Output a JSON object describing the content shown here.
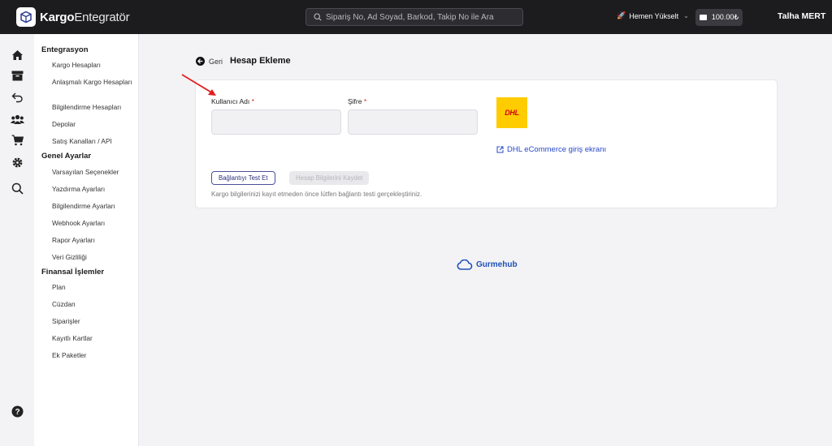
{
  "app": {
    "brand_bold": "Kargo",
    "brand_rest": "Entegratör"
  },
  "topbar": {
    "search_placeholder": "Sipariş No, Ad Soyad, Barkod, Takip No ile Ara",
    "upgrade_label": "Hemen Yükselt",
    "balance": "100.00₺",
    "user_name": "Talha MERT"
  },
  "rail": {
    "icons": [
      "home-icon",
      "archive-icon",
      "return-icon",
      "users-icon",
      "cart-icon",
      "gear-icon",
      "search-icon",
      "help-icon"
    ]
  },
  "sidebar": {
    "sections": [
      {
        "title": "Entegrasyon",
        "items": [
          "Kargo Hesapları",
          "Anlaşmalı Kargo Hesapları",
          "Bilgilendirme Hesapları",
          "Depolar",
          "Satış Kanalları / API"
        ]
      },
      {
        "title": "Genel Ayarlar",
        "items": [
          "Varsayılan Seçenekler",
          "Yazdırma Ayarları",
          "Bilgilendirme Ayarları",
          "Webhook Ayarları",
          "Rapor Ayarları",
          "Veri Gizliliği"
        ]
      },
      {
        "title": "Finansal İşlemler",
        "items": [
          "Plan",
          "Cüzdan",
          "Siparişler",
          "Kayıtlı Kartlar",
          "Ek Paketler"
        ]
      }
    ]
  },
  "main": {
    "back_label": "Geri",
    "title": "Hesap Ekleme",
    "form": {
      "username_label": "Kullanıcı Adı",
      "password_label": "Şifre",
      "required_mark": "*",
      "username_value": "",
      "password_value": ""
    },
    "carrier_logo_text": "DHL",
    "carrier_link": "DHL eCommerce giriş ekranı",
    "test_button": "Bağlantıyı Test Et",
    "save_button": "Hesap Bilgilerini Kaydet",
    "hint": "Kargo bilgilerinizi kayıt etmeden önce lütfen bağlantı testi gerçekleştiriniz."
  },
  "footer": {
    "brand": "Gurmehub"
  },
  "colors": {
    "topbar": "#1c1c1f",
    "accent": "#2848c7",
    "required": "#d0202a",
    "dhl_yellow": "#ffcc00",
    "dhl_red": "#d40511",
    "annotation_arrow": "#e02020"
  }
}
